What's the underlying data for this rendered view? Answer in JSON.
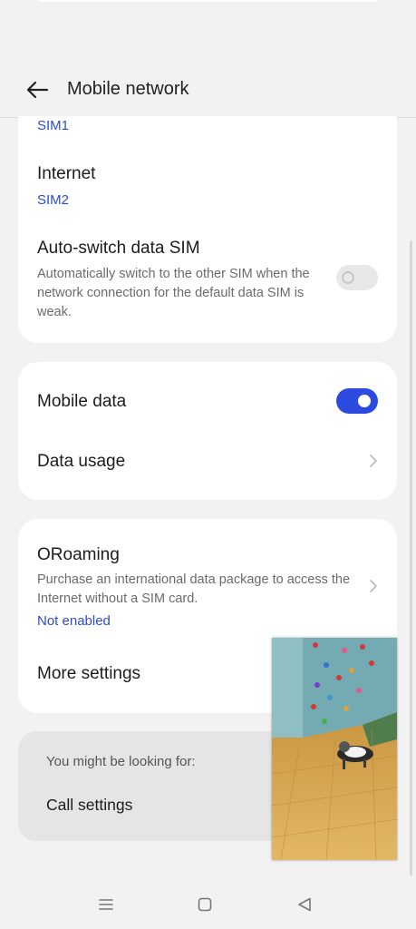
{
  "header": {
    "title": "Mobile network",
    "back_icon": "arrow-left-icon"
  },
  "sim_section": {
    "calls_value": "SIM1",
    "internet": {
      "title": "Internet",
      "value": "SIM2"
    },
    "auto_switch": {
      "title": "Auto-switch data SIM",
      "desc": "Automatically switch to the other SIM when the network connection for the default data SIM is weak.",
      "enabled": false
    }
  },
  "data_section": {
    "mobile_data": {
      "title": "Mobile data",
      "enabled": true
    },
    "data_usage": {
      "title": "Data usage"
    }
  },
  "roaming_section": {
    "oroaming": {
      "title": "ORoaming",
      "desc": "Purchase an international data package to access the Internet without a SIM card.",
      "status": "Not enabled"
    },
    "more_settings": {
      "title": "More settings"
    }
  },
  "suggestions": {
    "label": "You might be looking for:",
    "item": "Call settings"
  },
  "colors": {
    "accent": "#2c4ae0",
    "link": "#2d4bd2",
    "background": "#f2f2f2",
    "card": "#ffffff"
  },
  "navbar": {
    "icons": [
      "menu-icon",
      "home-icon",
      "back-triangle-icon"
    ]
  }
}
